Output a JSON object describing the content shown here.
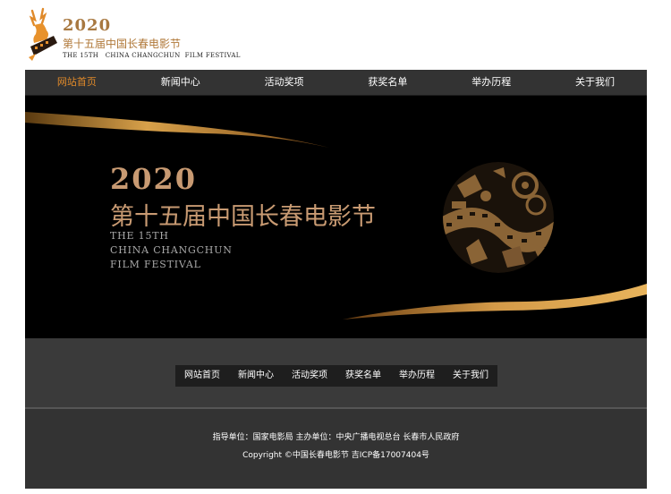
{
  "header": {
    "logo_year": "2020",
    "logo_title_cn": "第十五届中国长春电影节",
    "logo_title_en": "THE 15TH   CHINA CHANGCHUN  FILM FESTIVAL"
  },
  "nav": {
    "items": [
      {
        "label": "网站首页",
        "active": true
      },
      {
        "label": "新闻中心"
      },
      {
        "label": "活动奖项"
      },
      {
        "label": "获奖名单"
      },
      {
        "label": "举办历程"
      },
      {
        "label": "关于我们"
      }
    ]
  },
  "banner": {
    "year": "2020",
    "title_cn": "第十五届中国长春电影节",
    "en_lines": [
      "THE 15TH",
      "CHINA CHANGCHUN",
      "FILM FESTIVAL"
    ]
  },
  "footer": {
    "nav_items": [
      "网站首页",
      "新闻中心",
      "活动奖项",
      "获奖名单",
      "举办历程",
      "关于我们"
    ],
    "guide_line": "指导单位：国家电影局 主办单位：中央广播电视总台 长春市人民政府",
    "copyright_line": "Copyright ©中国长春电影节 吉ICP备17007404号"
  },
  "colors": {
    "accent": "#e08a2a",
    "gold": "#c89a72",
    "nav_bg": "#333333",
    "banner_bg": "#000000"
  }
}
